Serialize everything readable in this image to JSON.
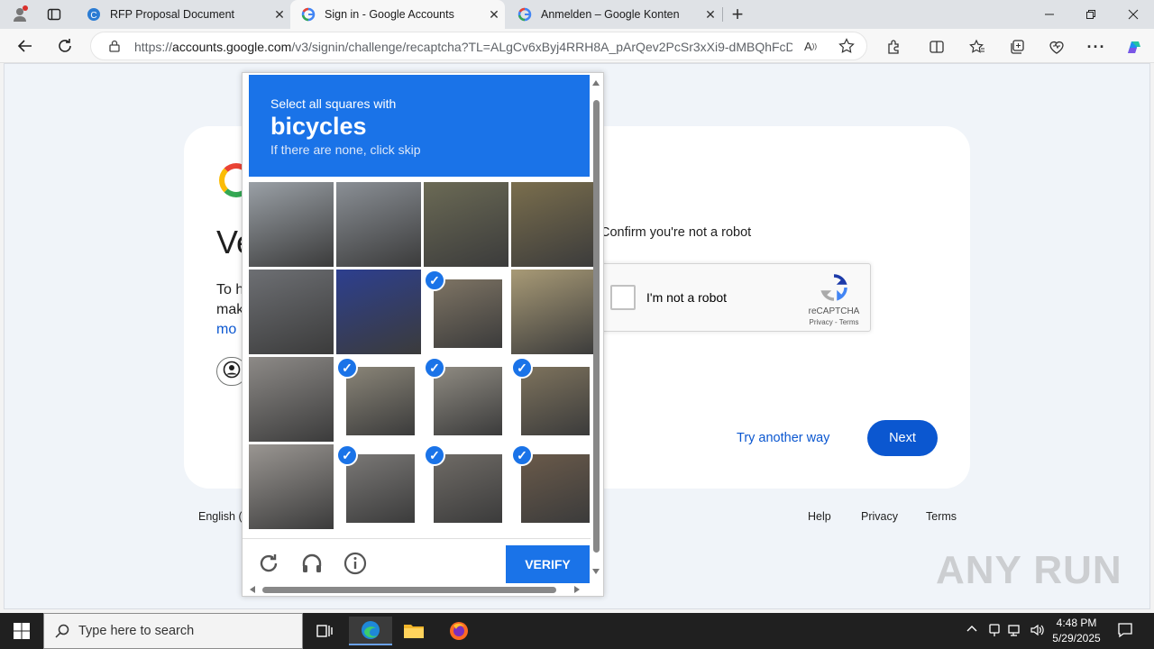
{
  "browser": {
    "tabs": [
      {
        "title": "RFP Proposal Document",
        "active": false
      },
      {
        "title": "Sign in - Google Accounts",
        "active": true
      },
      {
        "title": "Anmelden – Google Konten",
        "active": false
      }
    ],
    "url_prefix": "https://",
    "url_host": "accounts.google.com",
    "url_path": "/v3/signin/challenge/recaptcha?TL=ALgCv6xByj4RRH8A_pArQev2PcSr3xXi9-dMBQhFcDU..."
  },
  "signin_page": {
    "title_partial": "Ve",
    "para_line1": "To h",
    "para_line2": "mak",
    "para_link": "mo",
    "confirm_text": "Confirm you're not a robot",
    "recaptcha": {
      "checkbox_label": "I'm not a robot",
      "brand": "reCAPTCHA",
      "privacy": "Privacy",
      "terms_sep": " - ",
      "terms": "Terms"
    },
    "try_another_way": "Try another way",
    "next": "Next",
    "language_partial": "English (",
    "footer": {
      "help": "Help",
      "privacy": "Privacy",
      "terms": "Terms"
    }
  },
  "captcha": {
    "instruction_line1": "Select all squares with",
    "target": "bicycles",
    "instruction_line3": "If there are none, click skip",
    "grid_size": 4,
    "tiles": [
      {
        "selected": false,
        "color": "#9aa0a6"
      },
      {
        "selected": false,
        "color": "#8a8f95"
      },
      {
        "selected": false,
        "color": "#6b6a55"
      },
      {
        "selected": false,
        "color": "#7a6e4d"
      },
      {
        "selected": false,
        "color": "#6d6f73"
      },
      {
        "selected": false,
        "color": "#2d3f8f"
      },
      {
        "selected": true,
        "color": "#7e7464"
      },
      {
        "selected": false,
        "color": "#a89a76"
      },
      {
        "selected": false,
        "color": "#8d8a87"
      },
      {
        "selected": true,
        "color": "#8a8578"
      },
      {
        "selected": true,
        "color": "#8f8b82"
      },
      {
        "selected": true,
        "color": "#7e735d"
      },
      {
        "selected": false,
        "color": "#9a9692"
      },
      {
        "selected": true,
        "color": "#7a7876"
      },
      {
        "selected": true,
        "color": "#6f6b66"
      },
      {
        "selected": true,
        "color": "#6a5a4a"
      }
    ],
    "verify": "VERIFY",
    "icons": [
      "reload-icon",
      "audio-icon",
      "info-icon"
    ]
  },
  "watermark": "ANY RUN",
  "taskbar": {
    "search_placeholder": "Type here to search",
    "time": "4:48 PM",
    "date": "5/29/2025"
  }
}
